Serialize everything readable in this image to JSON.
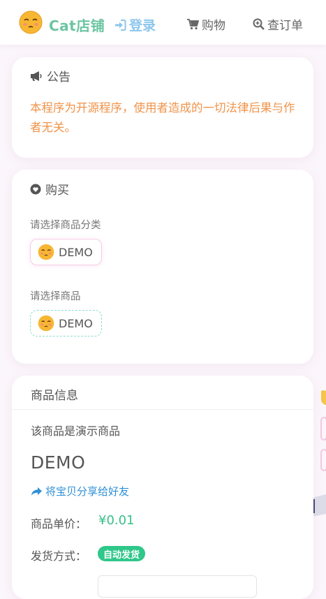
{
  "header": {
    "brand": "Cat店铺",
    "login": "登录",
    "shop": "购物",
    "order": "查订单"
  },
  "notice": {
    "title": "公告",
    "text": "本程序为开源程序，使用者造成的一切法律后果与作者无关。"
  },
  "buy": {
    "title": "购买",
    "category_label": "请选择商品分类",
    "category_option": "DEMO",
    "product_label": "请选择商品",
    "product_option": "DEMO"
  },
  "info": {
    "title": "商品信息",
    "description": "该商品是演示商品",
    "name": "DEMO",
    "share": "将宝贝分享给好友",
    "price_label": "商品单价：",
    "price": "¥0.01",
    "delivery_label": "发货方式：",
    "delivery_badge": "自动发货"
  },
  "colors": {
    "brand": "#6cc5a2",
    "login": "#8cc6ec",
    "notice_text": "#f0934a",
    "price": "#39c089",
    "badge": "#2fc78a",
    "share": "#2d8fd5"
  }
}
